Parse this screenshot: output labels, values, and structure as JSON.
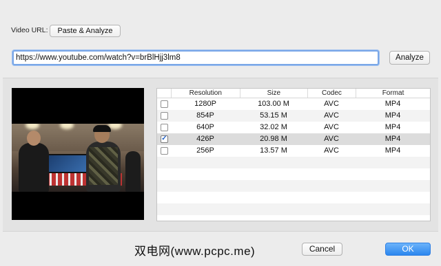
{
  "top": {
    "video_url_label": "Video URL:",
    "paste_analyze_label": "Paste & Analyze"
  },
  "url": {
    "value": "https://www.youtube.com/watch?v=brBlHjj3lm8",
    "analyze_label": "Analyze"
  },
  "table": {
    "columns": [
      "Resolution",
      "Size",
      "Codec",
      "Format"
    ],
    "rows": [
      {
        "resolution": "1280P",
        "size": "103.00 M",
        "codec": "AVC",
        "format": "MP4",
        "checked": false
      },
      {
        "resolution": "854P",
        "size": "53.15 M",
        "codec": "AVC",
        "format": "MP4",
        "checked": false
      },
      {
        "resolution": "640P",
        "size": "32.02 M",
        "codec": "AVC",
        "format": "MP4",
        "checked": false
      },
      {
        "resolution": "426P",
        "size": "20.98 M",
        "codec": "AVC",
        "format": "MP4",
        "checked": true
      },
      {
        "resolution": "256P",
        "size": "13.57 M",
        "codec": "AVC",
        "format": "MP4",
        "checked": false
      }
    ]
  },
  "footer": {
    "watermark": "双电网(www.pcpc.me)",
    "cancel_label": "Cancel",
    "ok_label": "OK"
  },
  "colors": {
    "accent": "#2b86ee",
    "focus_ring": "#7aa7e7"
  }
}
